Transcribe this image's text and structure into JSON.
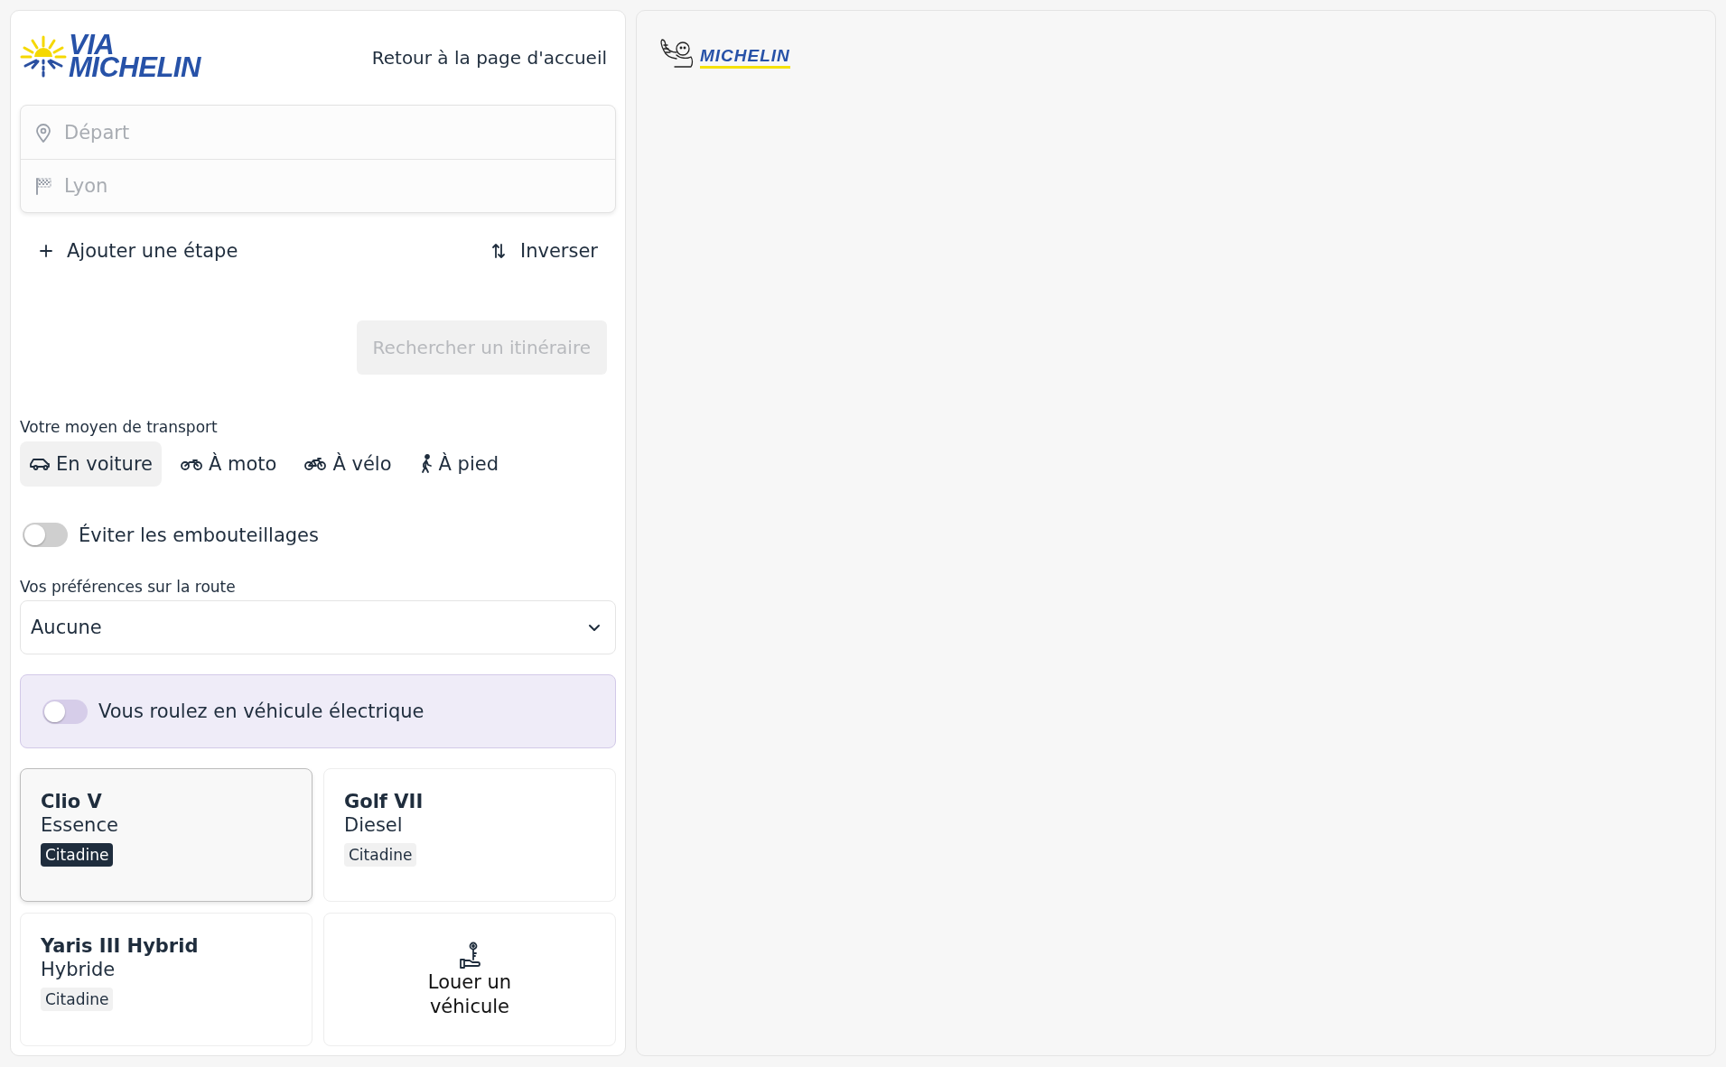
{
  "header": {
    "logo": {
      "line_1": "VIA",
      "line_2": "MICHELIN"
    },
    "home_link": "Retour à la page d'accueil"
  },
  "route_fields": [
    {
      "kind": "start",
      "placeholder": "Départ"
    },
    {
      "kind": "finish",
      "placeholder": "Lyon"
    }
  ],
  "add_stop": "Ajouter une étape",
  "swap": "Inverser",
  "search_button": {
    "label": "Rechercher un itinéraire",
    "disabled": true
  },
  "transport": {
    "label": "Votre moyen de transport",
    "modes": [
      {
        "kind": "car",
        "label": "En voiture",
        "selected": true
      },
      {
        "kind": "moto",
        "label": "À moto",
        "selected": false
      },
      {
        "kind": "bike",
        "label": "À vélo",
        "selected": false
      },
      {
        "kind": "walk",
        "label": "À pied",
        "selected": false
      }
    ]
  },
  "avoid_traffic": {
    "label": "Éviter les embouteillages",
    "on": false
  },
  "route_preferences": {
    "label": "Vos préférences sur la route",
    "value": "Aucune"
  },
  "electric_vehicle": {
    "label": "Vous roulez en véhicule électrique",
    "on": false
  },
  "vehicles": [
    {
      "kind": "car",
      "name": "Clio V",
      "fuel": "Essence",
      "category": "Citadine",
      "selected": true
    },
    {
      "kind": "car",
      "name": "Golf VII",
      "fuel": "Diesel",
      "category": "Citadine",
      "selected": false
    },
    {
      "kind": "car",
      "name": "Yaris III Hybrid",
      "fuel": "Hybride",
      "category": "Citadine",
      "selected": false
    },
    {
      "kind": "rent",
      "label": "Louer un véhicule"
    }
  ],
  "map": {
    "logo": "MICHELIN"
  }
}
